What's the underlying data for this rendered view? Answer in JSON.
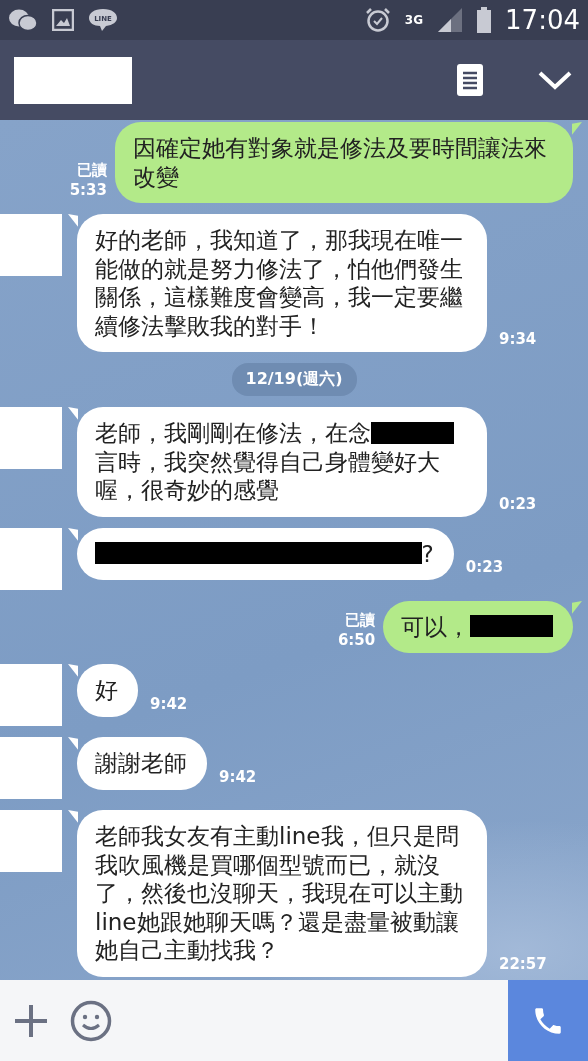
{
  "status_bar": {
    "notification_badge": "LINE",
    "network": "3G",
    "time": "17:04"
  },
  "header": {
    "title_redacted": true
  },
  "messages": [
    {
      "kind": "sent",
      "read_label": "已讀",
      "time": "5:33",
      "segments": [
        {
          "kind": "text",
          "text": "因確定她有對象就是修法及要時間讓法來改變"
        }
      ]
    },
    {
      "kind": "received",
      "time": "9:34",
      "segments": [
        {
          "kind": "text",
          "text": "好的老師，我知道了，那我現在唯一能做的就是努力修法了，怕他們發生關係，這樣難度會變高，我一定要繼續修法擊敗我的對手！"
        }
      ]
    },
    {
      "kind": "date",
      "text": "12/19(週六)"
    },
    {
      "kind": "received",
      "time": "0:23",
      "segments": [
        {
          "kind": "text",
          "text": "老師，我剛剛在修法，在念"
        },
        {
          "kind": "redaction"
        },
        {
          "kind": "text",
          "text": "言時，我突然覺得自己身體變好大喔，很奇妙的感覺"
        }
      ]
    },
    {
      "kind": "received",
      "time": "0:23",
      "segments": [
        {
          "kind": "redaction"
        },
        {
          "kind": "text",
          "text": "?"
        }
      ]
    },
    {
      "kind": "sent",
      "read_label": "已讀",
      "time": "6:50",
      "segments": [
        {
          "kind": "text",
          "text": "可以，"
        },
        {
          "kind": "redaction"
        }
      ]
    },
    {
      "kind": "received",
      "time": "9:42",
      "segments": [
        {
          "kind": "text",
          "text": "好"
        }
      ]
    },
    {
      "kind": "received",
      "time": "9:42",
      "segments": [
        {
          "kind": "text",
          "text": "謝謝老師"
        }
      ]
    },
    {
      "kind": "received",
      "time": "22:57",
      "segments": [
        {
          "kind": "text",
          "text": "老師我女友有主動line我，但只是問我吹風機是買哪個型號而已，就沒了，然後也沒聊天，我現在可以主動line她跟她聊天嗎？還是盡量被動讓她自己主動找我？"
        }
      ]
    }
  ]
}
